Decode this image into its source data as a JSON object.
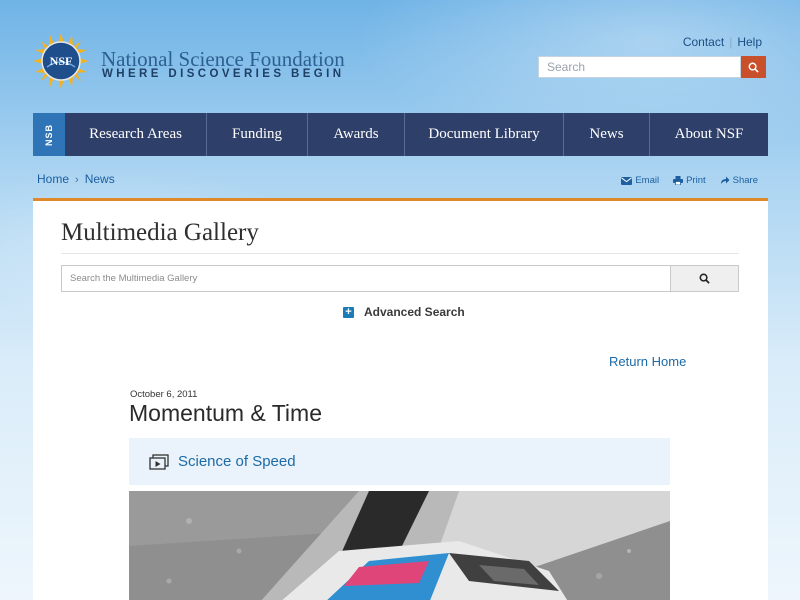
{
  "header": {
    "logo_text": "NSF",
    "org_name": "National Science Foundation",
    "tagline": "WHERE DISCOVERIES BEGIN",
    "utility_links": [
      "Contact",
      "Help"
    ],
    "search_placeholder": "Search"
  },
  "nav": {
    "badge": "NSB",
    "items": [
      "Research Areas",
      "Funding",
      "Awards",
      "Document Library",
      "News",
      "About NSF"
    ]
  },
  "breadcrumb": [
    "Home",
    "News"
  ],
  "share": {
    "email": "Email",
    "print": "Print",
    "share": "Share"
  },
  "gallery": {
    "title": "Multimedia Gallery",
    "search_placeholder": "Search the Multimedia Gallery",
    "advanced_search": "Advanced Search",
    "return_home": "Return Home"
  },
  "item": {
    "date": "October 6, 2011",
    "title": "Momentum & Time",
    "series_link": "Science of Speed"
  },
  "colors": {
    "nav_bg": "#2e3f6a",
    "nsb_badge": "#2f74b7",
    "accent_orange": "#c8502a",
    "panel_top_border": "#e0892a",
    "link_blue": "#1c6aa7"
  }
}
